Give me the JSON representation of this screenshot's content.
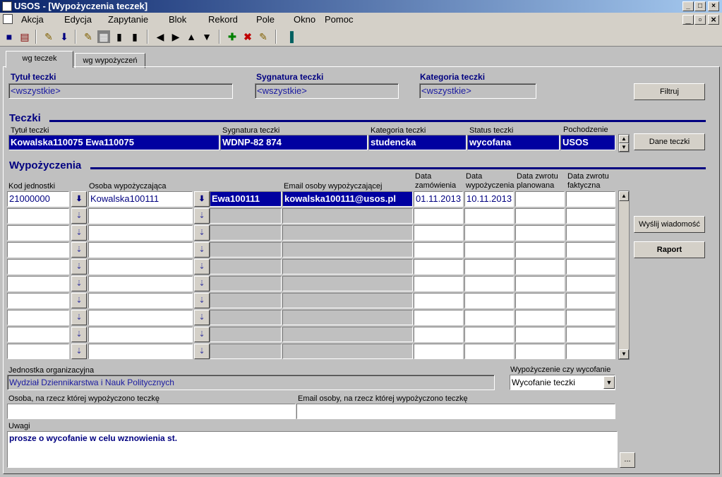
{
  "window": {
    "title": "USOS - [Wypożyczenia teczek]"
  },
  "menu": [
    "Akcja",
    "Edycja",
    "Zapytanie",
    "Blok",
    "Rekord",
    "Pole",
    "Okno",
    "Pomoc"
  ],
  "toolbar_icons": [
    "save-icon",
    "print-icon",
    "edit-icon",
    "download-icon",
    "query-icon",
    "execute-icon",
    "chart-icon",
    "list-icon",
    "prev-icon",
    "next-icon",
    "up-icon",
    "down-icon",
    "insert-icon",
    "delete-icon",
    "clear-icon",
    "exit-icon"
  ],
  "tabs": [
    "wg teczek",
    "wg wypożyczeń"
  ],
  "filter": {
    "title_label": "Tytuł teczki",
    "title_value": "<wszystkie>",
    "signature_label": "Sygnatura teczki",
    "signature_value": "<wszystkie>",
    "category_label": "Kategoria teczki",
    "category_value": "<wszystkie>",
    "button": "Filtruj"
  },
  "teczki": {
    "header": "Teczki",
    "col_title": "Tytuł teczki",
    "col_signature": "Sygnatura teczki",
    "col_category": "Kategoria teczki",
    "col_status": "Status teczki",
    "col_origin": "Pochodzenie",
    "title": "Kowalska110075 Ewa110075",
    "signature": "WDNP-82  874",
    "category": "studencka",
    "status": "wycofana",
    "origin": "USOS",
    "button": "Dane teczki"
  },
  "loans": {
    "header": "Wypożyczenia",
    "col_unit": "Kod jednostki",
    "col_person": "Osoba wypożyczająca",
    "col_email": "Email osoby wypożyczającej",
    "col_order": "Data zamówienia",
    "col_loan": "Data wypożyczenia",
    "col_return_planned": "Data zwrotu planowana",
    "col_return_actual": "Data zwrotu faktyczna",
    "rows": [
      {
        "unit": "21000000",
        "surname": "Kowalska100111",
        "name": "Ewa100111",
        "email": "kowalska100111@usos.pl",
        "order": "01.11.2013",
        "loan": "10.11.2013",
        "planned": "",
        "actual": ""
      }
    ],
    "send_button": "Wyślij wiadomość",
    "report_button": "Raport"
  },
  "details": {
    "unit_label": "Jednostka organizacyjna",
    "unit_value": "Wydział Dziennikarstwa i Nauk Politycznych",
    "loan_type_label": "Wypożyczenie czy wycofanie",
    "loan_type_value": "Wycofanie teczki",
    "person_label": "Osoba, na rzecz której wypożyczono teczkę",
    "person_value": "",
    "email_label": "Email osoby, na rzecz której wypożyczono teczkę",
    "email_value": "",
    "notes_label": "Uwagi",
    "notes_value": "prosze o wycofanie w celu wznowienia st.",
    "more_button": "..."
  }
}
